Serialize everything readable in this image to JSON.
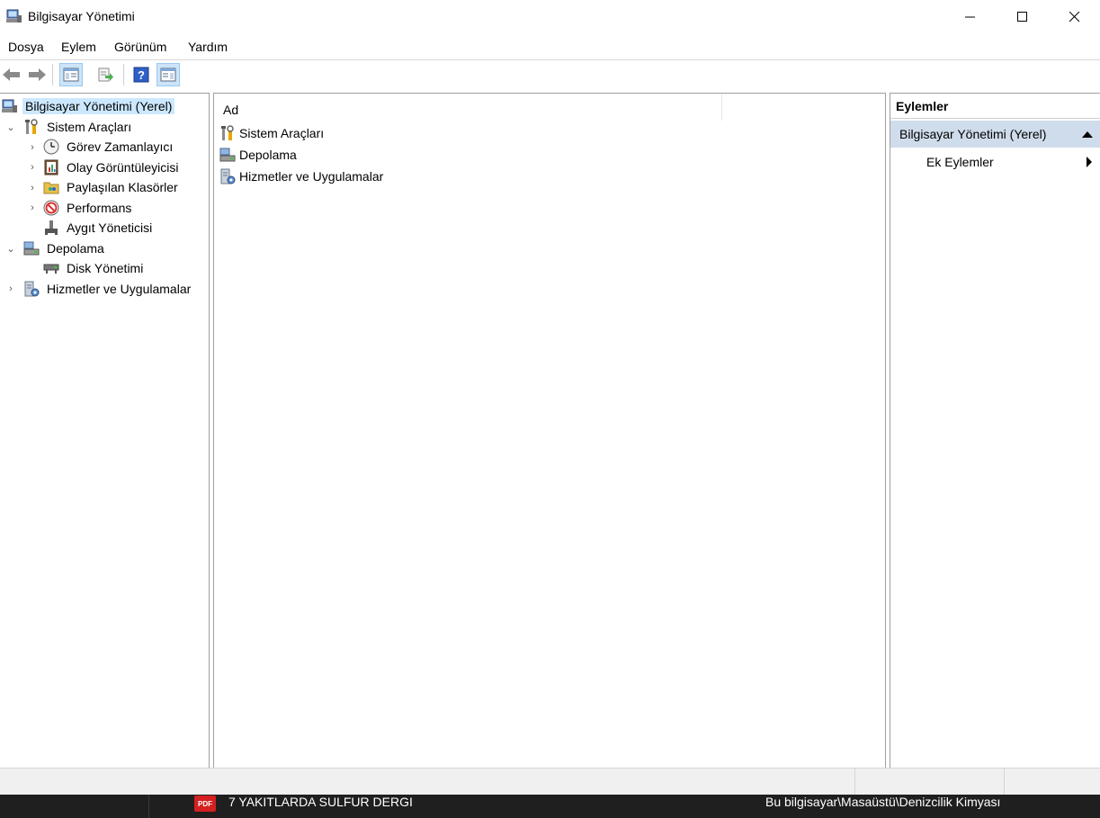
{
  "window": {
    "title": "Bilgisayar Yönetimi"
  },
  "menu": [
    "Dosya",
    "Eylem",
    "Görünüm",
    "Yardım"
  ],
  "tree": {
    "root": "Bilgisayar Yönetimi (Yerel)",
    "items": [
      {
        "label": "Sistem Araçları",
        "icon": "tools-icon"
      },
      {
        "label": "Görev Zamanlayıcı",
        "icon": "clock-icon"
      },
      {
        "label": "Olay Görüntüleyicisi",
        "icon": "event-viewer-icon"
      },
      {
        "label": "Paylaşılan Klasörler",
        "icon": "shared-folder-icon"
      },
      {
        "label": "Performans",
        "icon": "performance-icon"
      },
      {
        "label": "Aygıt Yöneticisi",
        "icon": "device-manager-icon"
      },
      {
        "label": "Depolama",
        "icon": "storage-icon"
      },
      {
        "label": "Disk Yönetimi",
        "icon": "disk-icon"
      },
      {
        "label": "Hizmetler ve Uygulamalar",
        "icon": "services-icon"
      }
    ]
  },
  "content": {
    "column_header": "Ad",
    "rows": [
      "Sistem Araçları",
      "Depolama",
      "Hizmetler ve Uygulamalar"
    ]
  },
  "actions": {
    "header": "Eylemler",
    "group": "Bilgisayar Yönetimi (Yerel)",
    "item": "Ek Eylemler"
  },
  "taskbar": {
    "file_label": "7 YAKITLARDA SULFUR DERGI",
    "pdf_badge": "PDF",
    "path": "Bu bilgisayar\\Masaüstü\\Denizcilik Kimyası"
  },
  "colors": {
    "selection": "#cce8ff",
    "actions_group": "#cfdceb",
    "taskbar": "#1f1f1f"
  }
}
